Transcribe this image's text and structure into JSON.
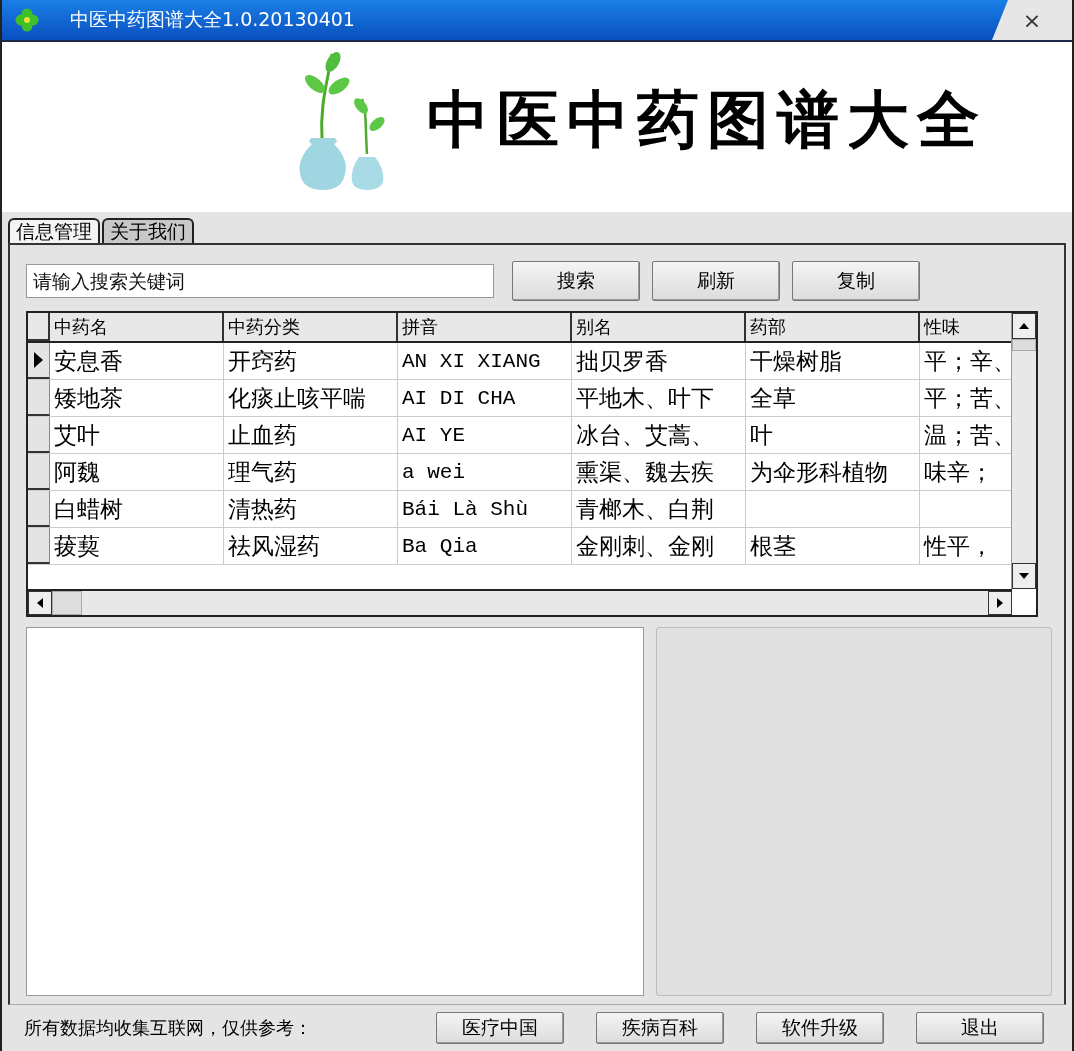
{
  "window": {
    "title": "中医中药图谱大全1.0.20130401",
    "close": "×"
  },
  "banner": {
    "heading": "中医中药图谱大全"
  },
  "tabs": [
    {
      "label": "信息管理",
      "selected": true
    },
    {
      "label": "关于我们",
      "selected": false
    }
  ],
  "search": {
    "placeholder": "请输入搜索关键词"
  },
  "search_buttons": [
    "搜索",
    "刷新",
    "复制"
  ],
  "table": {
    "columns": [
      "中药名",
      "中药分类",
      "拼音",
      "别名",
      "药部",
      "性味"
    ],
    "rows": [
      {
        "selected": true,
        "cells": [
          "安息香",
          "开窍药",
          "AN XI XIANG",
          "拙贝罗香",
          "干燥树脂",
          "平；辛、"
        ]
      },
      {
        "selected": false,
        "cells": [
          "矮地茶",
          "化痰止咳平喘",
          "AI DI CHA",
          "平地木、叶下",
          "全草",
          "平；苦、"
        ]
      },
      {
        "selected": false,
        "cells": [
          "艾叶",
          "止血药",
          "AI YE",
          "冰台、艾蒿、",
          "叶",
          "温；苦、"
        ]
      },
      {
        "selected": false,
        "cells": [
          "阿魏",
          "理气药",
          "a wei",
          "熏渠、魏去疾",
          "为伞形科植物",
          "味辛；"
        ]
      },
      {
        "selected": false,
        "cells": [
          "白蜡树",
          "清热药",
          "Bái Là Shù",
          "青榔木、白荆",
          "",
          ""
        ]
      },
      {
        "selected": false,
        "cells": [
          "菝葜",
          "祛风湿药",
          "Ba Qia",
          "金刚刺、金刚",
          "根茎",
          "性平，"
        ]
      }
    ]
  },
  "footer": {
    "note": "所有数据均收集互联网，仅供参考：",
    "buttons": [
      "医疗中国",
      "疾病百科",
      "软件升级",
      "退出"
    ]
  }
}
